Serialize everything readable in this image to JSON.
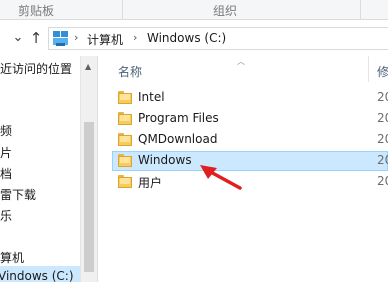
{
  "ribbon": {
    "group_clipboard": "剪贴板",
    "group_organize": "组织"
  },
  "nav_buttons": {
    "dropdown_glyph": "⌄",
    "up_glyph": "↑"
  },
  "address": {
    "crumbs": [
      "计算机",
      "Windows (C:)"
    ]
  },
  "nav_pane": {
    "items": [
      "近访问的位置",
      "频",
      "片",
      "档",
      "雷下载",
      "乐",
      "算机",
      "Vindows (C:)"
    ]
  },
  "file_list": {
    "columns": {
      "name": "名称",
      "date": "修"
    },
    "rows": [
      {
        "name": "Intel",
        "date": "20",
        "selected": false
      },
      {
        "name": "Program Files",
        "date": "20",
        "selected": false
      },
      {
        "name": "QMDownload",
        "date": "20",
        "selected": false
      },
      {
        "name": "Windows",
        "date": "20",
        "selected": true
      },
      {
        "name": "用户",
        "date": "20",
        "selected": false
      }
    ]
  },
  "colors": {
    "selection_bg": "#cce8ff",
    "selection_border": "#99d1ff",
    "annotation_arrow": "#e02020"
  },
  "icons": [
    "windows-computer-icon",
    "folder-icon",
    "up-arrow-icon",
    "dropdown-chevron-icon",
    "sort-ascending-icon"
  ]
}
